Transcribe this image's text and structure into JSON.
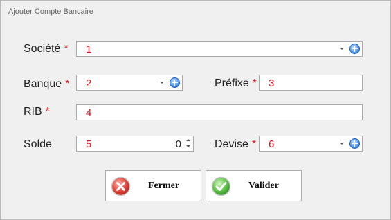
{
  "window": {
    "title": "Ajouter Compte Bancaire"
  },
  "form": {
    "societe": {
      "label": "Société",
      "required_mark": "*",
      "value": "1"
    },
    "banque": {
      "label": "Banque",
      "required_mark": "*",
      "value": "2"
    },
    "prefixe": {
      "label": "Préfixe",
      "required_mark": "*",
      "value": "3"
    },
    "rib": {
      "label": "RIB",
      "required_mark": "*",
      "value": "4"
    },
    "solde": {
      "label": "Solde",
      "value_tag": "5",
      "value": "0"
    },
    "devise": {
      "label": "Devise",
      "required_mark": "*",
      "value": "6"
    }
  },
  "buttons": {
    "close_label": "Fermer",
    "validate_label": "Valider"
  },
  "icons": {
    "dropdown": "chevron-down-icon",
    "add": "plus-circle-icon",
    "close": "close-circle-icon",
    "validate": "check-circle-icon",
    "spinner": "spinner-arrows-icon"
  },
  "colors": {
    "required": "#e0141e",
    "accent_blue": "#3e8ee8",
    "close_red": "#d9302a",
    "validate_green": "#3aa53a"
  }
}
